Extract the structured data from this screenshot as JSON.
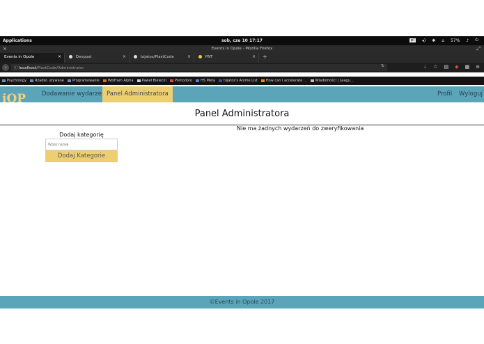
{
  "system": {
    "apps_label": "Applications",
    "clock": "sob, cze 10   17:17",
    "lang": "pl",
    "battery": "57%"
  },
  "browser": {
    "window_title": "Events in Opole - Mozilla Firefox",
    "tabs": [
      {
        "label": "Events in Opole"
      },
      {
        "label": "Devpost"
      },
      {
        "label": "tojatos/PlastCode"
      },
      {
        "label": "PNT"
      }
    ],
    "url_host": "localhost",
    "url_path": "/PlastCode/Administrator",
    "bookmarks": [
      {
        "label": "Psychology"
      },
      {
        "label": "Rzadko używane"
      },
      {
        "label": "Programowanie"
      },
      {
        "label": "Wolfram Alpha"
      },
      {
        "label": "Paweł Bielecki"
      },
      {
        "label": "Pomodoro"
      },
      {
        "label": "HS Meta"
      },
      {
        "label": "tojatos's Anime List"
      },
      {
        "label": "How can I accelerate ..."
      },
      {
        "label": "Wiadomości | Leagu..."
      }
    ]
  },
  "site": {
    "nav": {
      "add_event": "Dodawanie wydarzenia",
      "admin_panel": "Panel Administratora",
      "profile": "Profil",
      "logout": "Wyloguj"
    },
    "page_title": "Panel Administratora",
    "category": {
      "title": "Dodaj kategorię",
      "placeholder": "Wpisz nazwę",
      "button": "Dodaj Kategorie"
    },
    "empty_message": "Nie ma żadnych wydarzeń do zweryfikowania",
    "footer": "©Events in Opole 2017"
  }
}
